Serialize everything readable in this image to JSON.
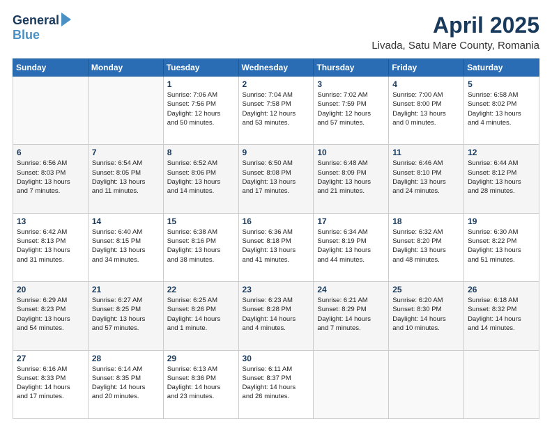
{
  "logo": {
    "general": "General",
    "blue": "Blue"
  },
  "title": {
    "month": "April 2025",
    "location": "Livada, Satu Mare County, Romania"
  },
  "weekdays": [
    "Sunday",
    "Monday",
    "Tuesday",
    "Wednesday",
    "Thursday",
    "Friday",
    "Saturday"
  ],
  "weeks": [
    [
      {
        "day": "",
        "info": ""
      },
      {
        "day": "",
        "info": ""
      },
      {
        "day": "1",
        "info": "Sunrise: 7:06 AM\nSunset: 7:56 PM\nDaylight: 12 hours\nand 50 minutes."
      },
      {
        "day": "2",
        "info": "Sunrise: 7:04 AM\nSunset: 7:58 PM\nDaylight: 12 hours\nand 53 minutes."
      },
      {
        "day": "3",
        "info": "Sunrise: 7:02 AM\nSunset: 7:59 PM\nDaylight: 12 hours\nand 57 minutes."
      },
      {
        "day": "4",
        "info": "Sunrise: 7:00 AM\nSunset: 8:00 PM\nDaylight: 13 hours\nand 0 minutes."
      },
      {
        "day": "5",
        "info": "Sunrise: 6:58 AM\nSunset: 8:02 PM\nDaylight: 13 hours\nand 4 minutes."
      }
    ],
    [
      {
        "day": "6",
        "info": "Sunrise: 6:56 AM\nSunset: 8:03 PM\nDaylight: 13 hours\nand 7 minutes."
      },
      {
        "day": "7",
        "info": "Sunrise: 6:54 AM\nSunset: 8:05 PM\nDaylight: 13 hours\nand 11 minutes."
      },
      {
        "day": "8",
        "info": "Sunrise: 6:52 AM\nSunset: 8:06 PM\nDaylight: 13 hours\nand 14 minutes."
      },
      {
        "day": "9",
        "info": "Sunrise: 6:50 AM\nSunset: 8:08 PM\nDaylight: 13 hours\nand 17 minutes."
      },
      {
        "day": "10",
        "info": "Sunrise: 6:48 AM\nSunset: 8:09 PM\nDaylight: 13 hours\nand 21 minutes."
      },
      {
        "day": "11",
        "info": "Sunrise: 6:46 AM\nSunset: 8:10 PM\nDaylight: 13 hours\nand 24 minutes."
      },
      {
        "day": "12",
        "info": "Sunrise: 6:44 AM\nSunset: 8:12 PM\nDaylight: 13 hours\nand 28 minutes."
      }
    ],
    [
      {
        "day": "13",
        "info": "Sunrise: 6:42 AM\nSunset: 8:13 PM\nDaylight: 13 hours\nand 31 minutes."
      },
      {
        "day": "14",
        "info": "Sunrise: 6:40 AM\nSunset: 8:15 PM\nDaylight: 13 hours\nand 34 minutes."
      },
      {
        "day": "15",
        "info": "Sunrise: 6:38 AM\nSunset: 8:16 PM\nDaylight: 13 hours\nand 38 minutes."
      },
      {
        "day": "16",
        "info": "Sunrise: 6:36 AM\nSunset: 8:18 PM\nDaylight: 13 hours\nand 41 minutes."
      },
      {
        "day": "17",
        "info": "Sunrise: 6:34 AM\nSunset: 8:19 PM\nDaylight: 13 hours\nand 44 minutes."
      },
      {
        "day": "18",
        "info": "Sunrise: 6:32 AM\nSunset: 8:20 PM\nDaylight: 13 hours\nand 48 minutes."
      },
      {
        "day": "19",
        "info": "Sunrise: 6:30 AM\nSunset: 8:22 PM\nDaylight: 13 hours\nand 51 minutes."
      }
    ],
    [
      {
        "day": "20",
        "info": "Sunrise: 6:29 AM\nSunset: 8:23 PM\nDaylight: 13 hours\nand 54 minutes."
      },
      {
        "day": "21",
        "info": "Sunrise: 6:27 AM\nSunset: 8:25 PM\nDaylight: 13 hours\nand 57 minutes."
      },
      {
        "day": "22",
        "info": "Sunrise: 6:25 AM\nSunset: 8:26 PM\nDaylight: 14 hours\nand 1 minute."
      },
      {
        "day": "23",
        "info": "Sunrise: 6:23 AM\nSunset: 8:28 PM\nDaylight: 14 hours\nand 4 minutes."
      },
      {
        "day": "24",
        "info": "Sunrise: 6:21 AM\nSunset: 8:29 PM\nDaylight: 14 hours\nand 7 minutes."
      },
      {
        "day": "25",
        "info": "Sunrise: 6:20 AM\nSunset: 8:30 PM\nDaylight: 14 hours\nand 10 minutes."
      },
      {
        "day": "26",
        "info": "Sunrise: 6:18 AM\nSunset: 8:32 PM\nDaylight: 14 hours\nand 14 minutes."
      }
    ],
    [
      {
        "day": "27",
        "info": "Sunrise: 6:16 AM\nSunset: 8:33 PM\nDaylight: 14 hours\nand 17 minutes."
      },
      {
        "day": "28",
        "info": "Sunrise: 6:14 AM\nSunset: 8:35 PM\nDaylight: 14 hours\nand 20 minutes."
      },
      {
        "day": "29",
        "info": "Sunrise: 6:13 AM\nSunset: 8:36 PM\nDaylight: 14 hours\nand 23 minutes."
      },
      {
        "day": "30",
        "info": "Sunrise: 6:11 AM\nSunset: 8:37 PM\nDaylight: 14 hours\nand 26 minutes."
      },
      {
        "day": "",
        "info": ""
      },
      {
        "day": "",
        "info": ""
      },
      {
        "day": "",
        "info": ""
      }
    ]
  ]
}
